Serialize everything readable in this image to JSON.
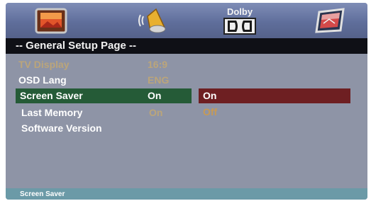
{
  "tabs": [
    {
      "name": "general-setup",
      "icon": "tv-icon"
    },
    {
      "name": "audio-setup",
      "icon": "speaker-icon"
    },
    {
      "name": "dolby-setup",
      "icon": "dolby-digital-icon",
      "label": "Dolby"
    },
    {
      "name": "video-setup",
      "icon": "picture-icon"
    }
  ],
  "page_title": "-- General Setup Page --",
  "settings": [
    {
      "label": "TV Display",
      "value": "16:9"
    },
    {
      "label": "OSD Lang",
      "value": "ENG"
    },
    {
      "label": "Screen Saver",
      "value": "On"
    },
    {
      "label": "Last Memory",
      "value": "On"
    },
    {
      "label": "Software Version",
      "value": ""
    }
  ],
  "options": [
    "On",
    "Off"
  ],
  "status_text": "Screen Saver",
  "colors": {
    "background": "#8e94a6",
    "tabbar": "#5f6e9b",
    "titlebar": "#0f1016",
    "selected_row": "#255b37",
    "selected_option": "#6e1f22",
    "dim_text": "#bba57a",
    "option_text": "#c79a55",
    "statusbar": "#6b9aa7"
  }
}
